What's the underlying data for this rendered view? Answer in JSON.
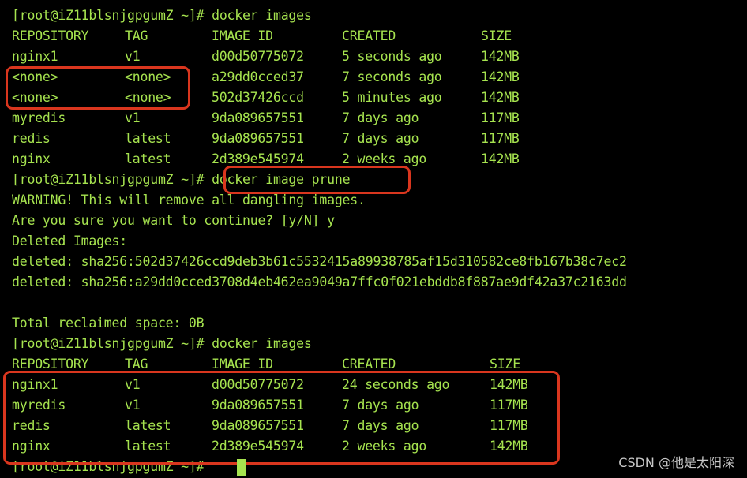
{
  "prompt": "[root@iZ11blsnjgpgumZ ~]# ",
  "cmd1": "docker images",
  "table1": {
    "headers": [
      "REPOSITORY",
      "TAG",
      "IMAGE ID",
      "CREATED",
      "SIZE"
    ],
    "rows": [
      [
        "nginx1",
        "v1",
        "d00d50775072",
        "5 seconds ago",
        "142MB"
      ],
      [
        "<none>",
        "<none>",
        "a29dd0cced37",
        "7 seconds ago",
        "142MB"
      ],
      [
        "<none>",
        "<none>",
        "502d37426ccd",
        "5 minutes ago",
        "142MB"
      ],
      [
        "myredis",
        "v1",
        "9da089657551",
        "7 days ago",
        "117MB"
      ],
      [
        "redis",
        "latest",
        "9da089657551",
        "7 days ago",
        "117MB"
      ],
      [
        "nginx",
        "latest",
        "2d389e545974",
        "2 weeks ago",
        "142MB"
      ]
    ]
  },
  "cmd2": "docker image prune",
  "output": [
    "WARNING! This will remove all dangling images.",
    "Are you sure you want to continue? [y/N] y",
    "Deleted Images:",
    "deleted: sha256:502d37426ccd9deb3b61c5532415a89938785af15d310582ce8fb167b38c7ec2",
    "deleted: sha256:a29dd0cced3708d4eb462ea9049a7ffc0f021ebddb8f887ae9df42a37c2163dd",
    "",
    "Total reclaimed space: 0B"
  ],
  "cmd3": "docker images",
  "table2": {
    "headers": [
      "REPOSITORY",
      "TAG",
      "IMAGE ID",
      "CREATED",
      "SIZE"
    ],
    "rows": [
      [
        "nginx1",
        "v1",
        "d00d50775072",
        "24 seconds ago",
        "142MB"
      ],
      [
        "myredis",
        "v1",
        "9da089657551",
        "7 days ago",
        "117MB"
      ],
      [
        "redis",
        "latest",
        "9da089657551",
        "7 days ago",
        "117MB"
      ],
      [
        "nginx",
        "latest",
        "2d389e545974",
        "2 weeks ago",
        "142MB"
      ]
    ]
  },
  "watermark": "CSDN @他是太阳深",
  "colors": {
    "text": "#a6e34f",
    "highlight": "#d9361e",
    "background": "#000000"
  }
}
